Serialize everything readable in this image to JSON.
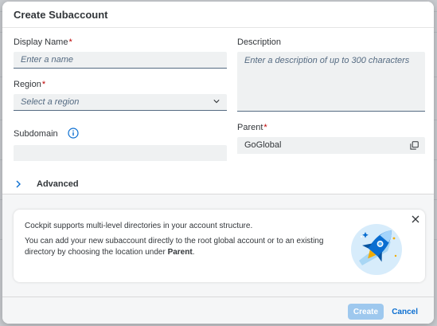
{
  "dialog": {
    "title": "Create Subaccount"
  },
  "form": {
    "display_name": {
      "label": "Display Name",
      "required": "*",
      "placeholder": "Enter a name"
    },
    "description": {
      "label": "Description",
      "placeholder": "Enter a description of up to 300 characters"
    },
    "region": {
      "label": "Region",
      "required": "*",
      "placeholder": "Select a region"
    },
    "subdomain": {
      "label": "Subdomain",
      "value": ""
    },
    "parent": {
      "label": "Parent",
      "required": "*",
      "value": "GoGlobal"
    },
    "advanced": {
      "label": "Advanced"
    }
  },
  "info": {
    "line1": "Cockpit supports multi-level directories in your account structure.",
    "line2_prefix": "You can add your new subaccount directly to the root global account or to an existing directory by choosing the location under ",
    "line2_bold": "Parent",
    "line2_suffix": "."
  },
  "footer": {
    "create_label": "Create",
    "cancel_label": "Cancel"
  },
  "colors": {
    "accent": "#0a6ed1",
    "required": "#bb0000",
    "create_disabled": "#9ec8ee"
  },
  "icons": {
    "info": "info-circle-icon",
    "dropdown": "chevron-down-icon",
    "copy": "copy-icon",
    "expand": "chevron-right-icon",
    "close": "close-icon",
    "illustration": "rocket-illustration"
  }
}
